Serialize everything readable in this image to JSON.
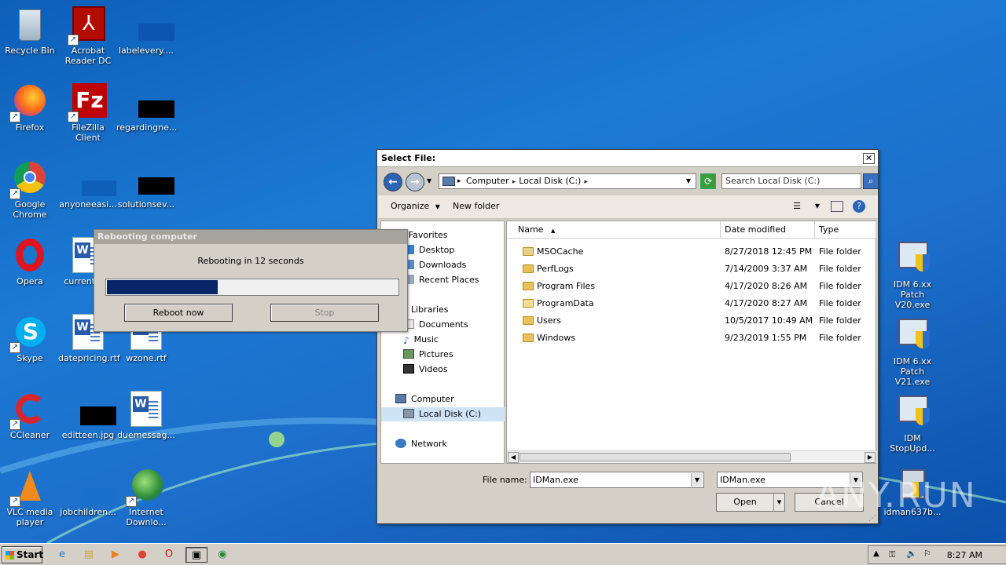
{
  "desktop": {
    "icons": [
      {
        "label": "Recycle Bin"
      },
      {
        "label": "Acrobat Reader DC"
      },
      {
        "label": "labelevery...."
      },
      {
        "label": "Firefox"
      },
      {
        "label": "FileZilla Client"
      },
      {
        "label": "regardingne..."
      },
      {
        "label": "Google Chrome"
      },
      {
        "label": "anyoneeasi..."
      },
      {
        "label": "solutionsev..."
      },
      {
        "label": "Opera"
      },
      {
        "label": "currentre..."
      },
      {
        "label": "Skype"
      },
      {
        "label": "datepricing.rtf"
      },
      {
        "label": "wzone.rtf"
      },
      {
        "label": "CCleaner"
      },
      {
        "label": "editteen.jpg"
      },
      {
        "label": "duemessag..."
      },
      {
        "label": "VLC media player"
      },
      {
        "label": "jobchildren..."
      },
      {
        "label": "Internet Downlo..."
      },
      {
        "label": "IDM 6.xx Patch V20.exe"
      },
      {
        "label": "IDM 6.xx Patch V21.exe"
      },
      {
        "label": "IDM StopUpd..."
      },
      {
        "label": "idman637b..."
      }
    ]
  },
  "file_dialog": {
    "title": "Select File:",
    "close_glyph": "✕",
    "breadcrumb": [
      "Computer",
      "Local Disk (C:)"
    ],
    "search_placeholder": "Search Local Disk (C:)",
    "toolbar": {
      "organize": "Organize",
      "new_folder": "New folder"
    },
    "nav": {
      "favorites": "Favorites",
      "desktop": "Desktop",
      "downloads": "Downloads",
      "recent": "Recent Places",
      "libraries": "Libraries",
      "documents": "Documents",
      "music": "Music",
      "pictures": "Pictures",
      "videos": "Videos",
      "computer": "Computer",
      "local_disk": "Local Disk (C:)",
      "network": "Network"
    },
    "columns": {
      "name": "Name",
      "date": "Date modified",
      "type": "Type"
    },
    "files": [
      {
        "name": "MSOCache",
        "date": "8/27/2018 12:45 PM",
        "type": "File folder"
      },
      {
        "name": "PerfLogs",
        "date": "7/14/2009 3:37 AM",
        "type": "File folder"
      },
      {
        "name": "Program Files",
        "date": "4/17/2020 8:26 AM",
        "type": "File folder"
      },
      {
        "name": "ProgramData",
        "date": "4/17/2020 8:27 AM",
        "type": "File folder"
      },
      {
        "name": "Users",
        "date": "10/5/2017 10:49 AM",
        "type": "File folder"
      },
      {
        "name": "Windows",
        "date": "9/23/2019 1:55 PM",
        "type": "File folder"
      }
    ],
    "filename_label": "File name:",
    "filename_value": "IDMan.exe",
    "filetype_value": "IDMan.exe",
    "open_label": "Open",
    "cancel_label": "Cancel"
  },
  "reboot_dialog": {
    "title": "Rebooting computer",
    "message": "Rebooting in 12 seconds",
    "progress": 0.38,
    "reboot_now": "Reboot now",
    "stop": "Stop"
  },
  "taskbar": {
    "start_label": "Start",
    "clock": "8:27 AM"
  },
  "watermark": "ANY.RUN"
}
